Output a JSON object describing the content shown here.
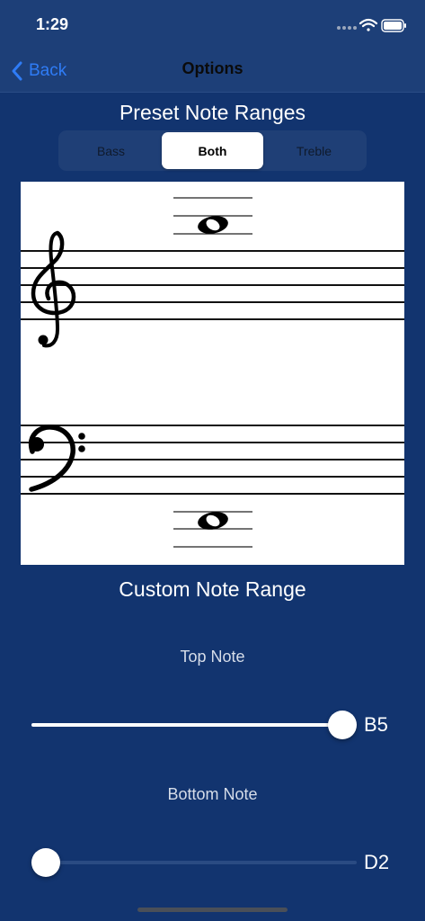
{
  "status_bar": {
    "time": "1:29"
  },
  "nav": {
    "back_label": "Back",
    "title": "Options"
  },
  "preset": {
    "title": "Preset Note Ranges",
    "segments": [
      "Bass",
      "Both",
      "Treble"
    ],
    "selected": "Both"
  },
  "custom": {
    "title": "Custom Note Range",
    "top": {
      "label": "Top Note",
      "value": "B5",
      "position": 1.0
    },
    "bottom": {
      "label": "Bottom Note",
      "value": "D2",
      "position": 0.0
    }
  },
  "colors": {
    "background": "#12346f",
    "nav_background": "#1d3f78",
    "accent": "#2f7cf6"
  }
}
